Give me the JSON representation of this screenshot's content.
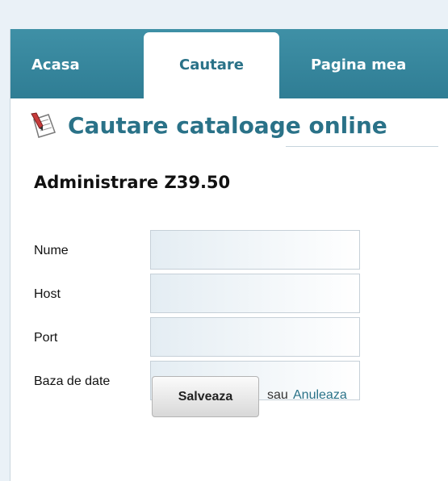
{
  "nav": {
    "tabs": [
      {
        "label": "Acasa",
        "active": false
      },
      {
        "label": "Cautare",
        "active": true
      },
      {
        "label": "Pagina mea",
        "active": false
      }
    ]
  },
  "page": {
    "title": "Cautare cataloage online",
    "title_icon": "notepad-pencil-icon",
    "section_title": "Administrare Z39.50"
  },
  "form": {
    "fields": [
      {
        "label": "Nume",
        "value": "",
        "placeholder": ""
      },
      {
        "label": "Host",
        "value": "",
        "placeholder": ""
      },
      {
        "label": "Port",
        "value": "",
        "placeholder": ""
      },
      {
        "label": "Baza de date",
        "value": "",
        "placeholder": ""
      }
    ],
    "save_label": "Salveaza",
    "or_text": "sau",
    "cancel_label": "Anuleaza"
  },
  "colors": {
    "nav_background": "#3488a0",
    "accent": "#2a7288",
    "page_background": "#eaf1f7"
  }
}
